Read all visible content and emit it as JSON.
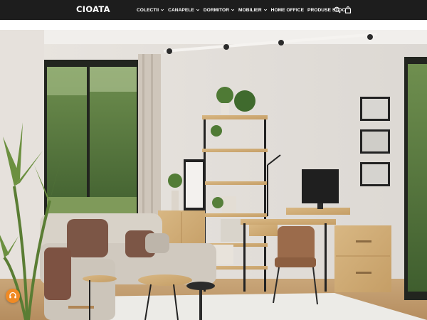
{
  "brand": {
    "name": "CIOATA"
  },
  "nav": {
    "items": [
      {
        "label": "COLECTII",
        "has_dropdown": true
      },
      {
        "label": "CANAPELE",
        "has_dropdown": true
      },
      {
        "label": "DORMITOR",
        "has_dropdown": true
      },
      {
        "label": "MOBILIER",
        "has_dropdown": true
      },
      {
        "label": "HOME OFFICE",
        "has_dropdown": false
      },
      {
        "label": "PRODUSE STOC",
        "has_dropdown": false
      }
    ]
  },
  "header_icons": [
    "search-icon",
    "shopping-bag-icon"
  ],
  "colors": {
    "header_bg": "#1d1d1d",
    "header_text": "#ffffff",
    "chat_button": "#f08a24"
  },
  "hero": {
    "image": "living-room-home-office-scene"
  },
  "chat": {
    "icon": "headset-icon"
  }
}
